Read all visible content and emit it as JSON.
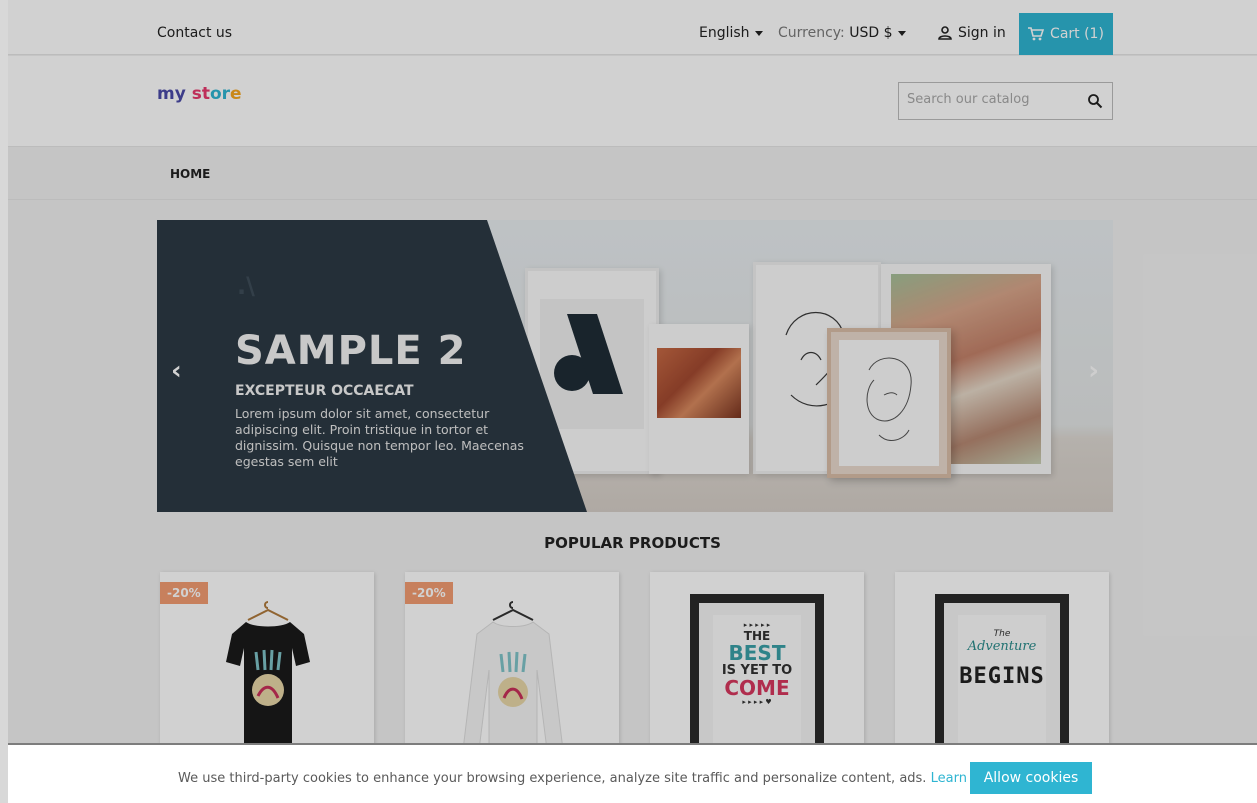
{
  "topbar": {
    "contact": "Contact us",
    "language": "English",
    "currency_label": "Currency:",
    "currency_value": "USD $",
    "signin": "Sign in",
    "cart": "Cart (1)"
  },
  "header": {
    "logo": [
      "my",
      " ",
      "st",
      "or",
      "e"
    ],
    "search_placeholder": "Search our catalog"
  },
  "menu": {
    "home": "HOME"
  },
  "slider": {
    "mark": ".\\",
    "title": "SAMPLE 2",
    "subtitle": "EXCEPTEUR OCCAECAT",
    "description": "Lorem ipsum dolor sit amet, consectetur adipiscing elit. Proin tristique in tortor et dignissim. Quisque non tempor leo. Maecenas egestas sem elit",
    "prev": "‹",
    "next": "›"
  },
  "popular": {
    "title": "POPULAR PRODUCTS",
    "products": [
      {
        "badge": "-20%"
      },
      {
        "badge": "-20%"
      },
      {
        "poster": [
          "▸ ▸ ▸ ▸ ▸",
          "THE",
          "BEST",
          "IS YET TO",
          "COME",
          "▸ ▸ ▸ ▸ ♥"
        ]
      },
      {
        "poster": [
          "The",
          "Adventure",
          "BEGINS"
        ]
      }
    ]
  },
  "cookie": {
    "message": "We use third-party cookies to enhance your browsing experience, analyze site traffic and personalize content, ads.",
    "learn_more": "Learn more.",
    "allow": "Allow cookies"
  }
}
